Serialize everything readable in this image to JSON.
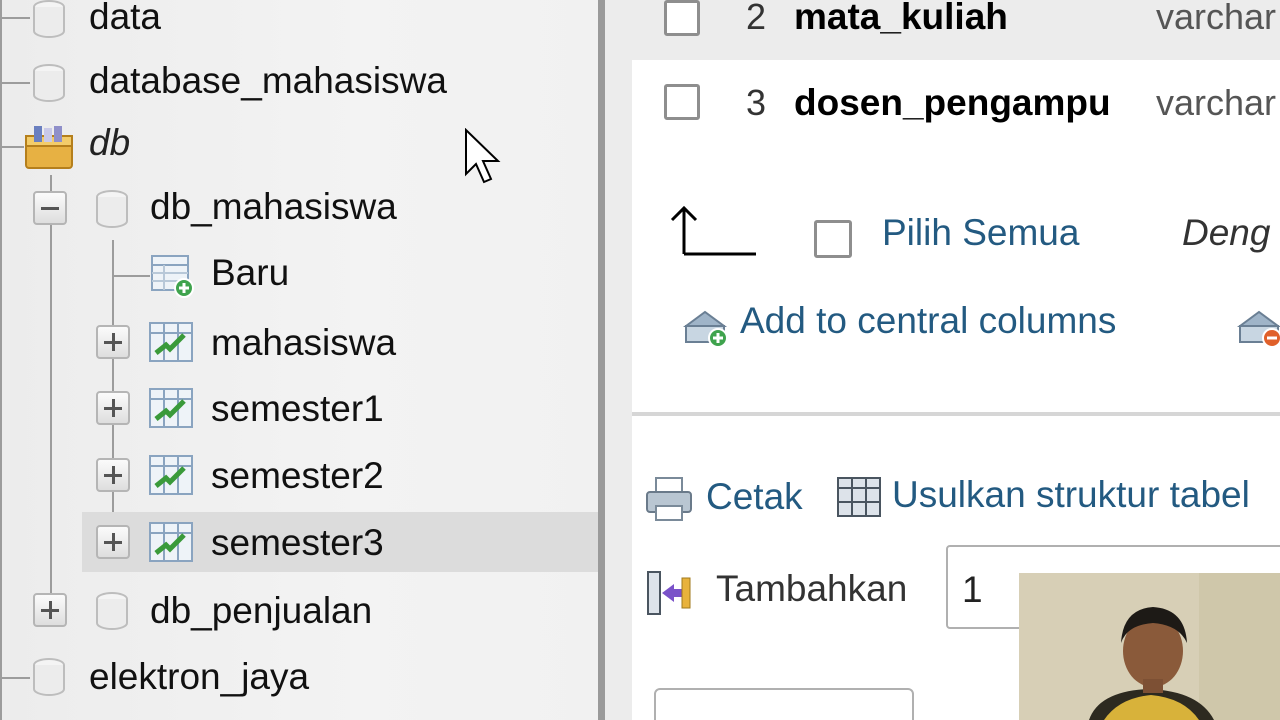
{
  "sidebar": {
    "items": [
      {
        "label": "data"
      },
      {
        "label": "database_mahasiswa"
      },
      {
        "label": "db"
      },
      {
        "label": "db_mahasiswa"
      },
      {
        "label": "Baru"
      },
      {
        "label": "mahasiswa"
      },
      {
        "label": "semester1"
      },
      {
        "label": "semester2"
      },
      {
        "label": "semester3"
      },
      {
        "label": "db_penjualan"
      },
      {
        "label": "elektron_jaya"
      }
    ]
  },
  "main": {
    "rows": [
      {
        "num": "2",
        "name": "mata_kuliah",
        "type": "varchar"
      },
      {
        "num": "3",
        "name": "dosen_pengampu",
        "type": "varchar"
      }
    ],
    "select_all_label": "Pilih Semua",
    "with_selected_label": "Deng",
    "add_central_label": "Add to central columns",
    "print_label": "Cetak",
    "propose_label": "Usulkan struktur tabel",
    "add_columns_label": "Tambahkan",
    "add_columns_value": "1"
  },
  "colors": {
    "link": "#235a81",
    "sidebar_bg": "#f1f1f1",
    "divider": "#9a9a9a"
  }
}
